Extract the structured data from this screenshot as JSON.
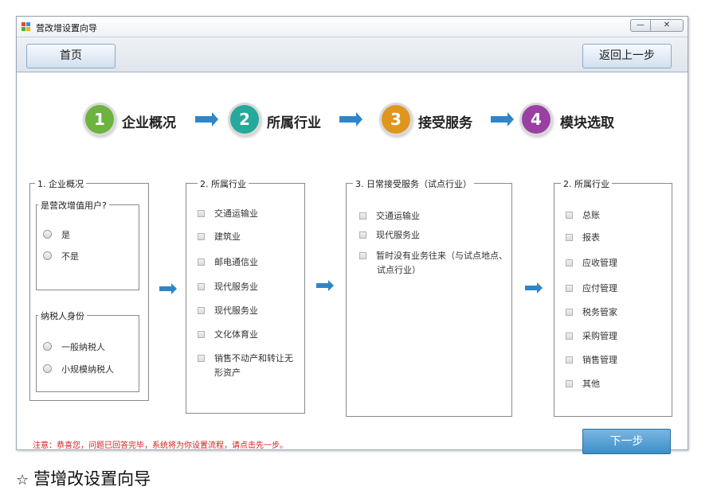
{
  "window": {
    "title": "营改增设置向导",
    "minimize": "—",
    "close": "✕"
  },
  "toolbar": {
    "home_label": "首页",
    "back_label": "返回上一步"
  },
  "steps": [
    {
      "number": "1",
      "label": "企业概况",
      "color": "#6cb33f"
    },
    {
      "number": "2",
      "label": "所属行业",
      "color": "#26a89a"
    },
    {
      "number": "3",
      "label": "接受服务",
      "color": "#e0961e"
    },
    {
      "number": "4",
      "label": "模块选取",
      "color": "#9a3fa3"
    }
  ],
  "group1": {
    "legend": "1. 企业概况",
    "vat_user": {
      "legend": "是营改增值用户?",
      "options": [
        "是",
        "不是"
      ]
    },
    "taxpayer": {
      "legend": "纳税人身份",
      "options": [
        "一般纳税人",
        "小规模纳税人"
      ]
    }
  },
  "group2": {
    "legend": "2. 所属行业",
    "options": [
      "交通运输业",
      "建筑业",
      "邮电通信业",
      "现代服务业",
      "现代服务业",
      "文化体育业",
      "销售不动产和转让无",
      "形资产"
    ]
  },
  "group3": {
    "legend": "3. 日常接受服务（试点行业）",
    "options": [
      "交通运输业",
      "现代服务业",
      "暂时没有业务往来（与试点地点、",
      "试点行业）"
    ]
  },
  "group4": {
    "legend": "2. 所属行业",
    "options": [
      "总账",
      "报表",
      "应收管理",
      "应付管理",
      "税务管家",
      "采购管理",
      "销售管理",
      "其他"
    ]
  },
  "notice": "注意：恭喜您，问题已回答完毕，系统将为你设置流程，请点击先一步。",
  "next_label": "下一步",
  "caption": {
    "star": "☆",
    "text": "营增改设置向导"
  },
  "colors": {
    "accent_blue": "#2e86c8",
    "notice_red": "#d51e1e",
    "next_button": "#3d8fc8"
  }
}
